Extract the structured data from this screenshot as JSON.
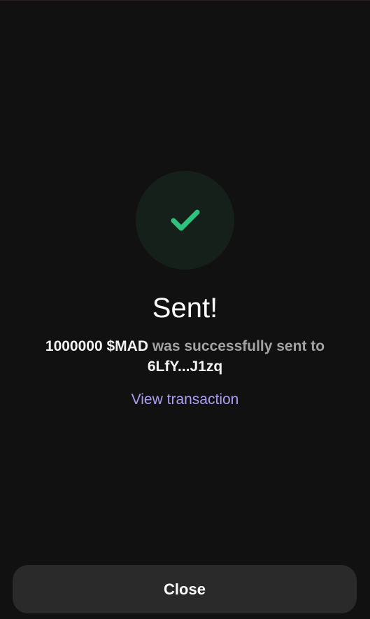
{
  "status": {
    "icon": "checkmark-icon",
    "title": "Sent!"
  },
  "message": {
    "amount": "1000000 $MAD",
    "middle": " was successfully sent to ",
    "recipient": "6LfY...J1zq"
  },
  "links": {
    "view_transaction": "View transaction"
  },
  "footer": {
    "close_label": "Close"
  },
  "colors": {
    "background": "#111111",
    "success_green": "#2ec27e",
    "success_circle": "#15201a",
    "link_purple": "#ab9ff2",
    "button_bg": "#2a2a2a"
  }
}
